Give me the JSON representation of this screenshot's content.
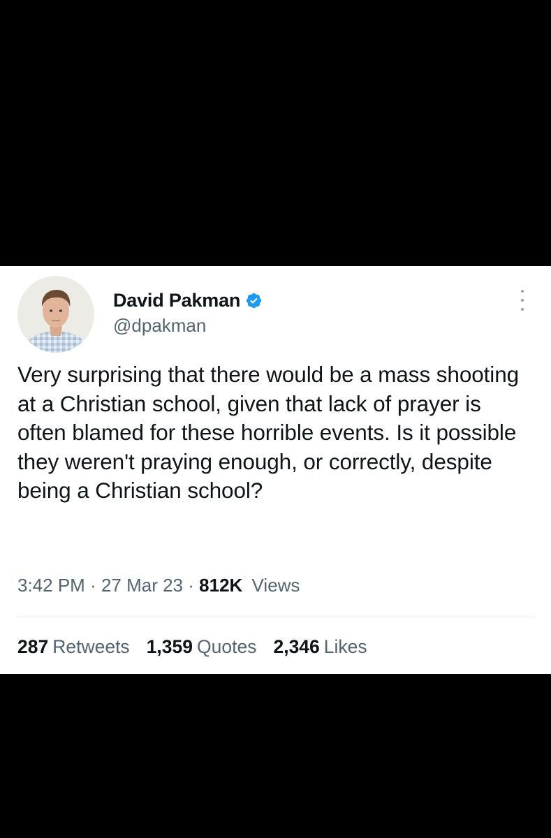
{
  "author": {
    "display_name": "David Pakman",
    "handle": "@dpakman",
    "verified_icon": "verified-badge-icon",
    "verified_color": "#1d9bf0"
  },
  "tweet": {
    "text": "Very surprising that there would be a mass shooting at a Christian school, given that lack of prayer is often blamed for these horrible events. Is it possible they weren't praying enough, or correctly, despite being a Christian school?",
    "time": "3:42 PM",
    "date": "27 Mar 23",
    "separator": "·",
    "views_count": "812K",
    "views_label": "Views"
  },
  "stats": {
    "retweets_count": "287",
    "retweets_label": "Retweets",
    "quotes_count": "1,359",
    "quotes_label": "Quotes",
    "likes_count": "2,346",
    "likes_label": "Likes"
  },
  "menu_icon": "more-options-icon",
  "colors": {
    "background": "#000000",
    "card": "#ffffff",
    "text_primary": "#0f1419",
    "text_secondary": "#536471"
  }
}
